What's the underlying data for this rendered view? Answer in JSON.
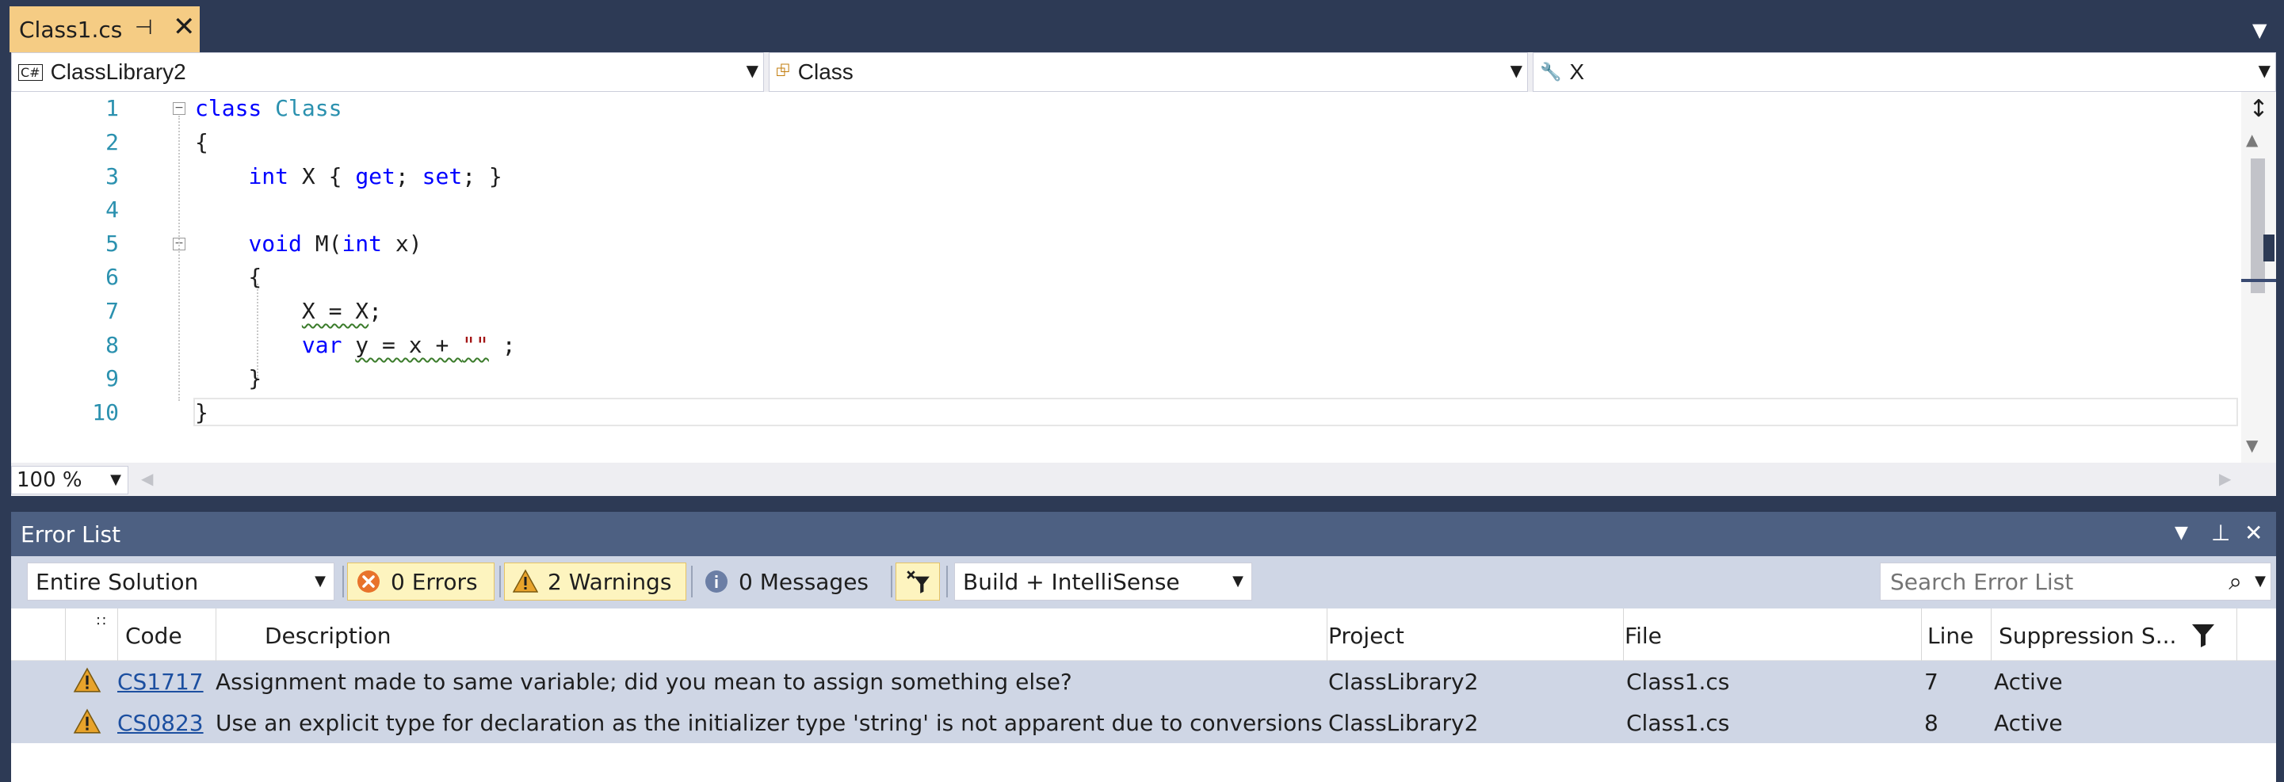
{
  "tab": {
    "label": "Class1.cs"
  },
  "nav": {
    "project": "ClassLibrary2",
    "type": "Class",
    "member": "X"
  },
  "code": {
    "line_numbers": [
      "1",
      "2",
      "3",
      "4",
      "5",
      "6",
      "7",
      "8",
      "9",
      "10"
    ]
  },
  "zoom": {
    "value": "100 %"
  },
  "error_list": {
    "title": "Error List",
    "scope": "Entire Solution",
    "errors_label": "0 Errors",
    "warnings_label": "2 Warnings",
    "messages_label": "0 Messages",
    "build_filter": "Build + IntelliSense",
    "search_placeholder": "Search Error List",
    "columns": {
      "code": "Code",
      "description": "Description",
      "project": "Project",
      "file": "File",
      "line": "Line",
      "suppression": "Suppression S..."
    },
    "rows": [
      {
        "code": "CS1717",
        "description": "Assignment made to same variable; did you mean to assign something else?",
        "project": "ClassLibrary2",
        "file": "Class1.cs",
        "line": "7",
        "suppression": "Active"
      },
      {
        "code": "CS0823",
        "description": "Use an explicit type for declaration as the initializer type 'string' is not apparent due to conversions",
        "project": "ClassLibrary2",
        "file": "Class1.cs",
        "line": "8",
        "suppression": "Active"
      }
    ]
  },
  "colors": {
    "window_bg": "#2d3a55",
    "active_tab": "#f5cc84",
    "toolwindow_title": "#4d6082",
    "selected_row": "#cfd6e5",
    "keyword": "#0000ff",
    "type_name": "#2b91af",
    "string": "#a31515"
  }
}
